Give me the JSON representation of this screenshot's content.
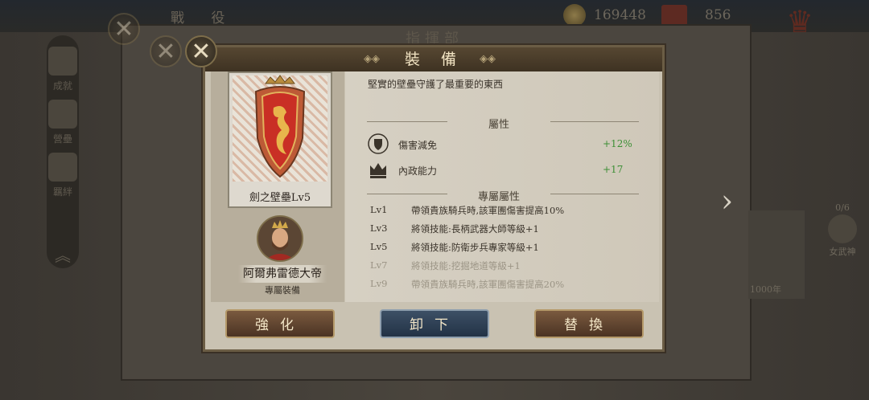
{
  "topbar": {
    "title": "戰 役",
    "coins": "169448",
    "gems": "856"
  },
  "sidebar": {
    "items": [
      {
        "label": "成就"
      },
      {
        "label": "營壘"
      },
      {
        "label": "羈絆"
      }
    ]
  },
  "background": {
    "panel_title": "指揮部",
    "right_count": "0/6",
    "right_label": "女武神",
    "bottom_tag": "1000年"
  },
  "dialog": {
    "title": "裝 備",
    "item_name": "劍之壁壘Lv5",
    "description": "堅實的壁壘守護了最重要的東西",
    "owner_name": "阿爾弗雷德大帝",
    "owner_note": "專屬裝備",
    "attributes_title": "屬性",
    "attributes": [
      {
        "icon": "shield-icon",
        "name": "傷害減免",
        "value": "+12%"
      },
      {
        "icon": "crown-icon",
        "name": "內政能力",
        "value": "+17"
      }
    ],
    "exclusive_title": "專屬屬性",
    "exclusive": [
      {
        "level": "Lv1",
        "text": "帶領貴族騎兵時,該軍團傷害提高10%",
        "active": true
      },
      {
        "level": "Lv3",
        "text": "將領技能:長柄武器大師等級+1",
        "active": true
      },
      {
        "level": "Lv5",
        "text": "將領技能:防衛步兵專家等級+1",
        "active": true
      },
      {
        "level": "Lv7",
        "text": "將領技能:挖掘地道等級+1",
        "active": false
      },
      {
        "level": "Lv9",
        "text": "帶領貴族騎兵時,該軍團傷害提高20%",
        "active": false
      }
    ],
    "buttons": {
      "enhance": "強化",
      "unequip": "卸下",
      "replace": "替換"
    }
  },
  "colors": {
    "bonus_green": "#3d8f36",
    "header_brown": "#4a3b28",
    "parchment": "#d3ccbd"
  }
}
